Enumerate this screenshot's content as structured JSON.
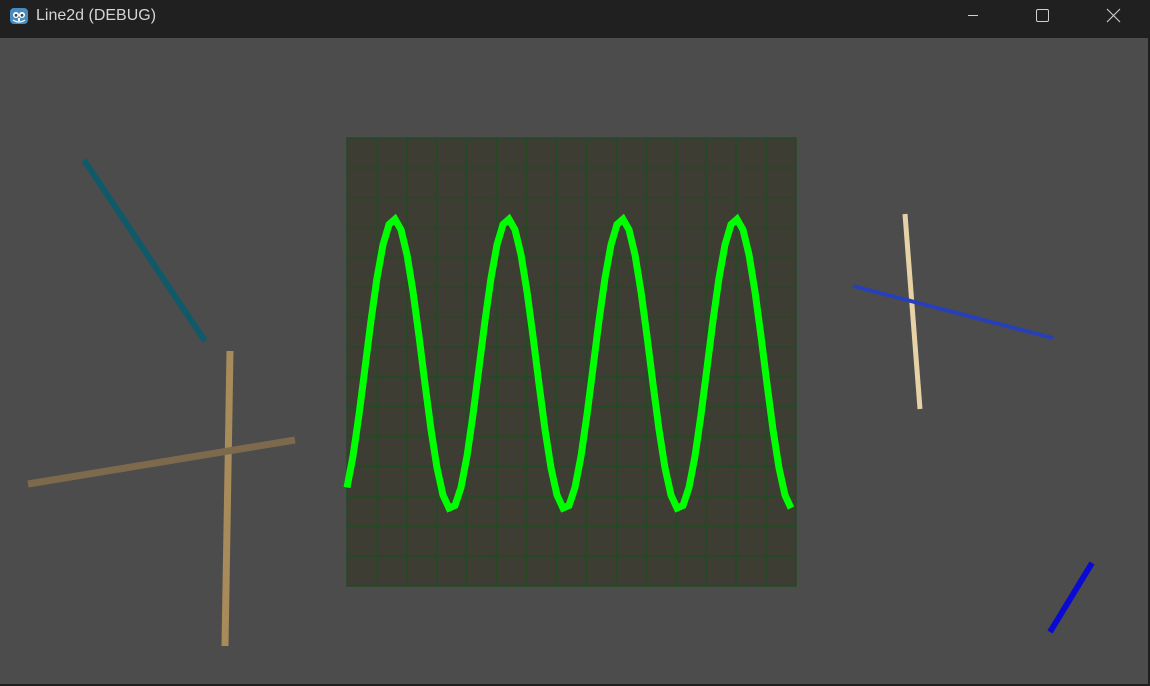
{
  "window": {
    "title": "Line2d (DEBUG)",
    "app_icon": "godot-icon",
    "controls": [
      "minimize-icon",
      "maximize-icon",
      "close-icon"
    ]
  },
  "scene": {
    "background_color": "#4c4c4c",
    "grid": {
      "background_color": "#3d3d33",
      "line_color": "#244a24",
      "columns": 15,
      "rows": 15
    },
    "wave": {
      "color": "#00ff00",
      "cycles": 4
    },
    "lines": [
      {
        "name": "teal-line",
        "color": "#0e5a68"
      },
      {
        "name": "tan-vertical-line",
        "color": "#a88b5a"
      },
      {
        "name": "brown-line",
        "color": "#7d6a4c"
      },
      {
        "name": "cream-line",
        "color": "#e6d2a6"
      },
      {
        "name": "blue-line",
        "color": "#2740b8"
      },
      {
        "name": "dark-blue-line",
        "color": "#0a0ad2"
      }
    ]
  }
}
